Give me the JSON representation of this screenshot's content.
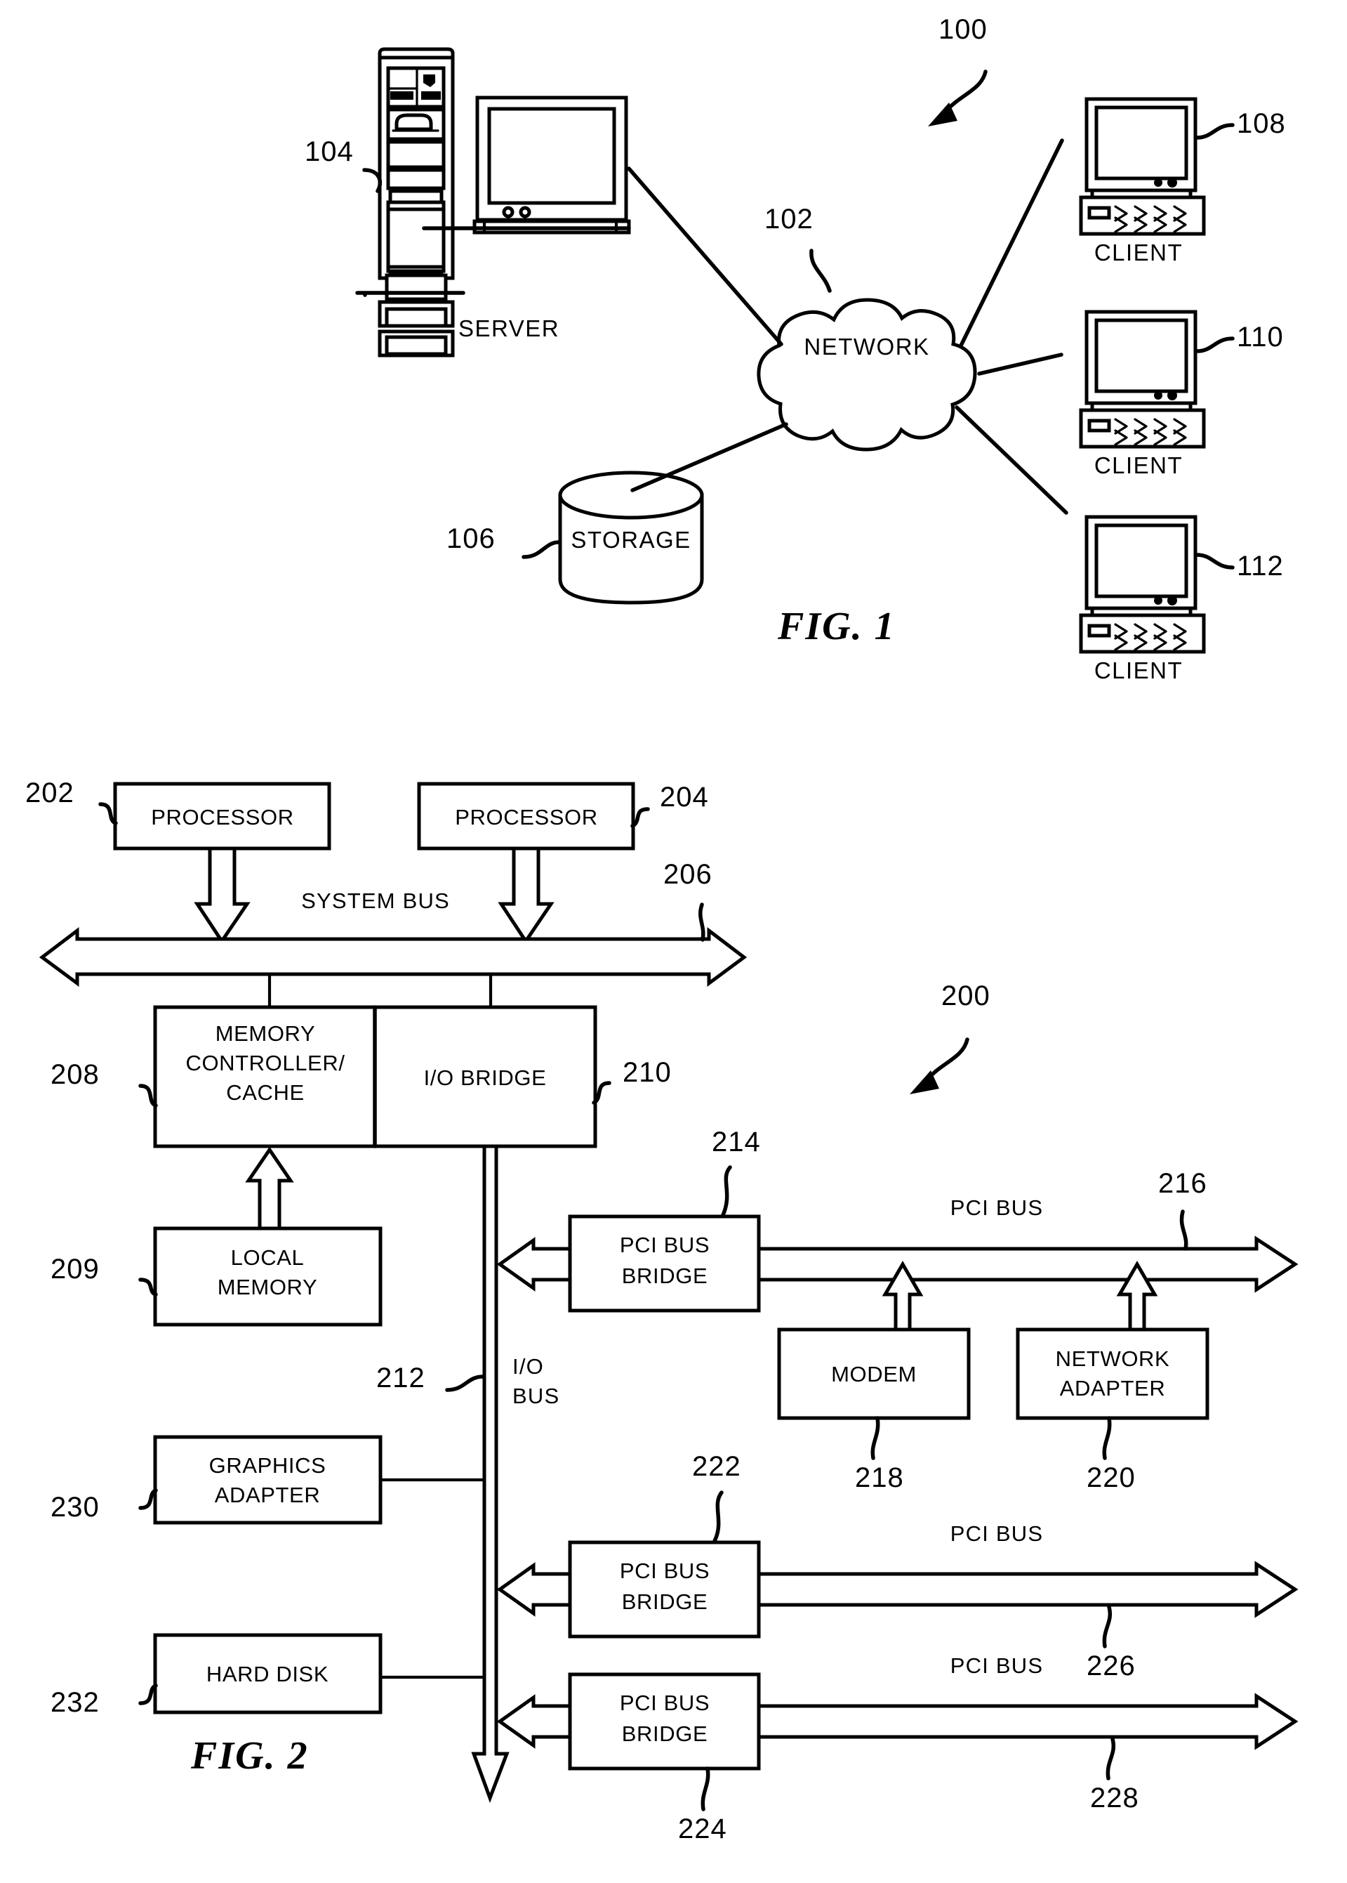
{
  "document": {
    "type": "patent-figure-sheet",
    "figures": [
      "FIG. 1",
      "FIG. 2"
    ]
  },
  "figure1": {
    "caption": "FIG. 1",
    "system_ref": "100",
    "nodes": {
      "server": {
        "label": "SERVER",
        "ref": "104"
      },
      "network": {
        "label": "NETWORK",
        "ref": "102"
      },
      "storage": {
        "label": "STORAGE",
        "ref": "106"
      },
      "client1": {
        "label": "CLIENT",
        "ref": "108"
      },
      "client2": {
        "label": "CLIENT",
        "ref": "110"
      },
      "client3": {
        "label": "CLIENT",
        "ref": "112"
      }
    },
    "connections": [
      {
        "from": "server",
        "to": "network"
      },
      {
        "from": "storage",
        "to": "network"
      },
      {
        "from": "network",
        "to": "client1"
      },
      {
        "from": "network",
        "to": "client2"
      },
      {
        "from": "network",
        "to": "client3"
      }
    ]
  },
  "figure2": {
    "caption": "FIG. 2",
    "system_ref": "200",
    "blocks": {
      "processor1": {
        "label": "PROCESSOR",
        "ref": "202"
      },
      "processor2": {
        "label": "PROCESSOR",
        "ref": "204"
      },
      "memory_controller": {
        "label": "MEMORY\nCONTROLLER/\nCACHE",
        "line1": "MEMORY",
        "line2": "CONTROLLER/",
        "line3": "CACHE",
        "ref": "208"
      },
      "io_bridge": {
        "label": "I/O BRIDGE",
        "ref": "210"
      },
      "local_memory": {
        "line1": "LOCAL",
        "line2": "MEMORY",
        "ref": "209"
      },
      "graphics_adapter": {
        "line1": "GRAPHICS",
        "line2": "ADAPTER",
        "ref": "230"
      },
      "hard_disk": {
        "label": "HARD DISK",
        "ref": "232"
      },
      "pci_bridge_1": {
        "line1": "PCI BUS",
        "line2": "BRIDGE",
        "ref": "214"
      },
      "pci_bridge_2": {
        "line1": "PCI BUS",
        "line2": "BRIDGE",
        "ref": "222"
      },
      "pci_bridge_3": {
        "line1": "PCI BUS",
        "line2": "BRIDGE",
        "ref": "224"
      },
      "modem": {
        "label": "MODEM",
        "ref": "218"
      },
      "network_adapter": {
        "line1": "NETWORK",
        "line2": "ADAPTER",
        "ref": "220"
      }
    },
    "buses": {
      "system_bus": {
        "label": "SYSTEM BUS",
        "ref": "206"
      },
      "io_bus": {
        "line1": "I/O",
        "line2": "BUS",
        "ref": "212"
      },
      "pci_bus_1": {
        "label": "PCI BUS",
        "ref": "216"
      },
      "pci_bus_2": {
        "label": "PCI BUS",
        "ref": "226"
      },
      "pci_bus_3": {
        "label": "PCI BUS",
        "ref": "228"
      }
    }
  }
}
